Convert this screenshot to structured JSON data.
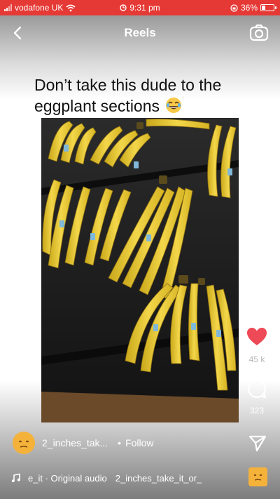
{
  "status_bar": {
    "carrier": "vodafone UK",
    "time": "9:31 pm",
    "battery": "36%",
    "battery_level": 0.36,
    "background_color": "#e53935"
  },
  "header": {
    "title": "Reels",
    "back_icon": "chevron-left-icon",
    "camera_icon": "camera-icon"
  },
  "post": {
    "caption": "Don’t take this dude to the eggplant sections",
    "caption_emoji": "laughing-emoji",
    "video_subject": "bananas",
    "author": {
      "username": "2_inches_tak...",
      "separator": "•",
      "follow_label": "Follow",
      "avatar_icon": "avatar-emoji"
    },
    "audio": {
      "prefix": "e_it · Original audio",
      "creator": "2_inches_take_it_or_"
    }
  },
  "actions": {
    "like_count": "45 k",
    "like_color": "#ed4956",
    "comment_count": "323"
  }
}
